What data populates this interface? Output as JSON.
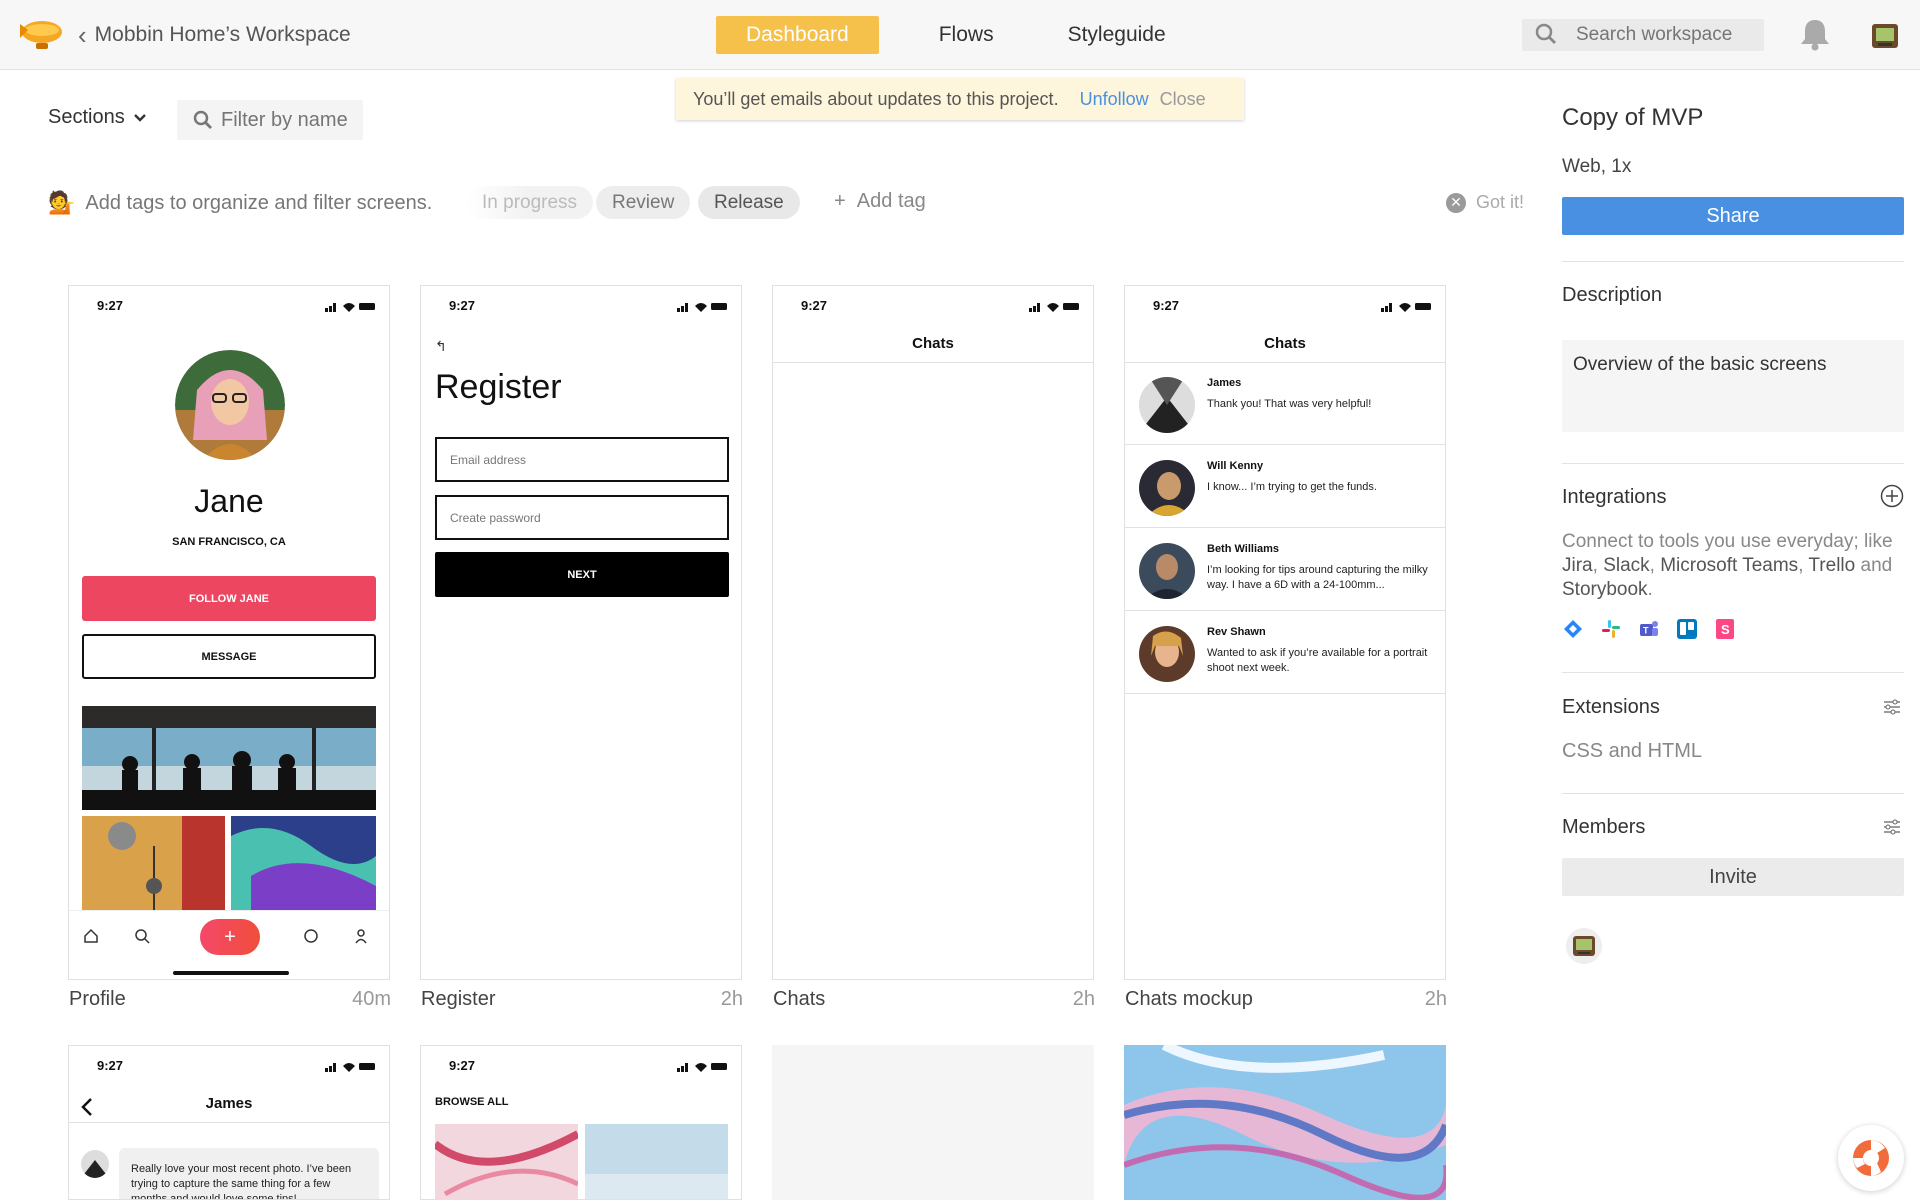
{
  "header": {
    "workspace": "Mobbin Home’s Workspace",
    "tabs": [
      {
        "label": "Dashboard",
        "active": true
      },
      {
        "label": "Flows",
        "active": false
      },
      {
        "label": "Styleguide",
        "active": false
      }
    ],
    "search_placeholder": "Search workspace",
    "accent": "#f5c14b"
  },
  "toast": {
    "message": "You’ll get emails about updates to this project.",
    "unfollow": "Unfollow",
    "close": "Close"
  },
  "filters": {
    "sections": "Sections",
    "filter_placeholder": "Filter by name",
    "hint": "Add tags to organize and filter screens.",
    "tags": [
      "In progress",
      "Review",
      "Release"
    ],
    "add_tag": "Add tag",
    "got_it": "Got it!"
  },
  "screens": [
    {
      "caption": "Profile",
      "time": "40m",
      "status_time": "9:27",
      "name": "Jane",
      "location": "SAN FRANCISCO, CA",
      "follow": "FOLLOW JANE",
      "message": "MESSAGE"
    },
    {
      "caption": "Register",
      "time": "2h",
      "status_time": "9:27",
      "title": "Register",
      "email_placeholder": "Email address",
      "password_placeholder": "Create password",
      "next": "NEXT"
    },
    {
      "caption": "Chats",
      "time": "2h",
      "status_time": "9:27",
      "title": "Chats"
    },
    {
      "caption": "Chats mockup",
      "time": "2h",
      "status_time": "9:27",
      "title": "Chats",
      "rows": [
        {
          "name": "James",
          "text": "Thank you! That was very helpful!"
        },
        {
          "name": "Will Kenny",
          "text": "I know... I’m trying to get the funds."
        },
        {
          "name": "Beth Williams",
          "text": "I’m looking for tips around capturing the milky way. I have a 6D with a 24-100mm..."
        },
        {
          "name": "Rev Shawn",
          "text": "Wanted to ask if you’re available for a portrait shoot next week."
        }
      ]
    },
    {
      "status_time": "9:27",
      "title": "James",
      "bubble": "Really love your most recent photo. I’ve been trying to capture the same thing for a few months and would love some tips!"
    },
    {
      "status_time": "9:27",
      "title": "BROWSE ALL"
    }
  ],
  "panel": {
    "title": "Copy of MVP",
    "subtitle": "Web, 1x",
    "share": "Share",
    "description_label": "Description",
    "description": "Overview of the basic screens",
    "integrations_label": "Integrations",
    "integrations_text_pre": "Connect to tools you use everyday; like ",
    "integrations_tools": [
      "Jira",
      "Slack",
      "Microsoft Teams",
      "Trello",
      "Storybook"
    ],
    "integrations_icons": [
      "jira-icon",
      "slack-icon",
      "teams-icon",
      "trello-icon",
      "storybook-icon"
    ],
    "extensions_label": "Extensions",
    "extensions_value": "CSS and HTML",
    "members_label": "Members",
    "invite": "Invite",
    "share_color": "#4a90e2"
  }
}
